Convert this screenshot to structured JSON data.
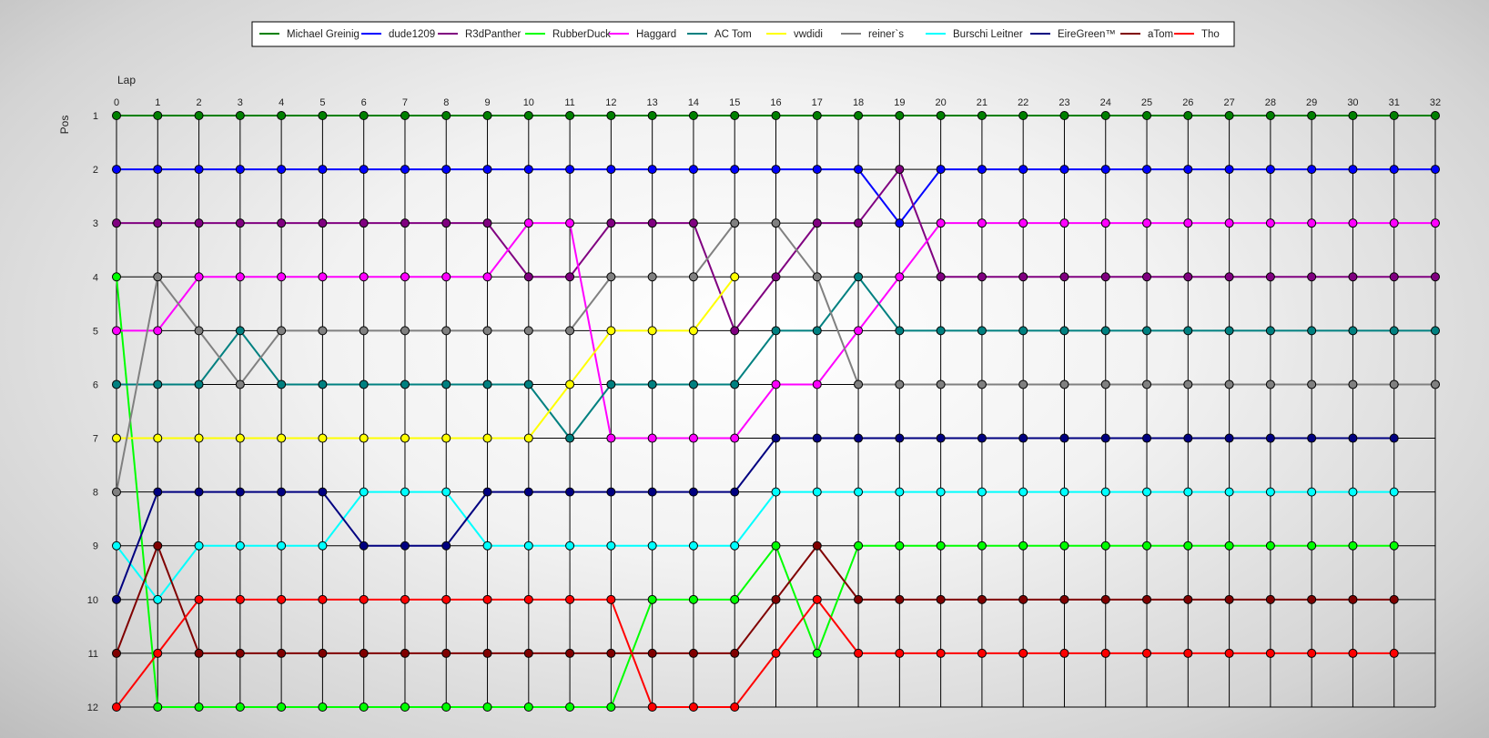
{
  "chart_data": {
    "type": "line",
    "xlabel": "Lap",
    "ylabel": "Pos",
    "x": [
      0,
      1,
      2,
      3,
      4,
      5,
      6,
      7,
      8,
      9,
      10,
      11,
      12,
      13,
      14,
      15,
      16,
      17,
      18,
      19,
      20,
      21,
      22,
      23,
      24,
      25,
      26,
      27,
      28,
      29,
      30,
      31,
      32
    ],
    "y_ticks": [
      1,
      2,
      3,
      4,
      5,
      6,
      7,
      8,
      9,
      10,
      11,
      12
    ],
    "ylim": [
      1,
      12
    ],
    "y_inverted": true,
    "xlim": [
      0,
      32
    ],
    "grid": true,
    "legend_position": "top-center",
    "series": [
      {
        "name": "Michael Greinig",
        "color": "#008000",
        "values": [
          1,
          1,
          1,
          1,
          1,
          1,
          1,
          1,
          1,
          1,
          1,
          1,
          1,
          1,
          1,
          1,
          1,
          1,
          1,
          1,
          1,
          1,
          1,
          1,
          1,
          1,
          1,
          1,
          1,
          1,
          1,
          1,
          1
        ]
      },
      {
        "name": "dude1209",
        "color": "#0000ff",
        "values": [
          2,
          2,
          2,
          2,
          2,
          2,
          2,
          2,
          2,
          2,
          2,
          2,
          2,
          2,
          2,
          2,
          2,
          2,
          2,
          3,
          2,
          2,
          2,
          2,
          2,
          2,
          2,
          2,
          2,
          2,
          2,
          2,
          2
        ]
      },
      {
        "name": "R3dPanther",
        "color": "#800080",
        "values": [
          3,
          3,
          3,
          3,
          3,
          3,
          3,
          3,
          3,
          3,
          4,
          4,
          3,
          3,
          3,
          5,
          4,
          3,
          3,
          2,
          4,
          4,
          4,
          4,
          4,
          4,
          4,
          4,
          4,
          4,
          4,
          4,
          4
        ]
      },
      {
        "name": "RubberDuck",
        "color": "#00ff00",
        "values": [
          4,
          12,
          12,
          12,
          12,
          12,
          12,
          12,
          12,
          12,
          12,
          12,
          12,
          10,
          10,
          10,
          9,
          11,
          9,
          9,
          9,
          9,
          9,
          9,
          9,
          9,
          9,
          9,
          9,
          9,
          9,
          9
        ]
      },
      {
        "name": "Haggard",
        "color": "#ff00ff",
        "values": [
          5,
          5,
          4,
          4,
          4,
          4,
          4,
          4,
          4,
          4,
          3,
          3,
          7,
          7,
          7,
          7,
          6,
          6,
          5,
          4,
          3,
          3,
          3,
          3,
          3,
          3,
          3,
          3,
          3,
          3,
          3,
          3,
          3
        ]
      },
      {
        "name": "AC Tom",
        "color": "#008080",
        "values": [
          6,
          6,
          6,
          5,
          6,
          6,
          6,
          6,
          6,
          6,
          6,
          7,
          6,
          6,
          6,
          6,
          5,
          5,
          4,
          5,
          5,
          5,
          5,
          5,
          5,
          5,
          5,
          5,
          5,
          5,
          5,
          5,
          5
        ]
      },
      {
        "name": "vwdidi",
        "color": "#ffff00",
        "values": [
          7,
          7,
          7,
          7,
          7,
          7,
          7,
          7,
          7,
          7,
          7,
          6,
          5,
          5,
          5,
          4
        ]
      },
      {
        "name": "reiner`s",
        "color": "#808080",
        "values": [
          8,
          4,
          5,
          6,
          5,
          5,
          5,
          5,
          5,
          5,
          5,
          5,
          4,
          4,
          4,
          3,
          3,
          4,
          6,
          6,
          6,
          6,
          6,
          6,
          6,
          6,
          6,
          6,
          6,
          6,
          6,
          6,
          6
        ]
      },
      {
        "name": "Burschi Leitner",
        "color": "#00ffff",
        "values": [
          9,
          10,
          9,
          9,
          9,
          9,
          8,
          8,
          8,
          9,
          9,
          9,
          9,
          9,
          9,
          9,
          8,
          8,
          8,
          8,
          8,
          8,
          8,
          8,
          8,
          8,
          8,
          8,
          8,
          8,
          8,
          8
        ]
      },
      {
        "name": "EireGreen™",
        "color": "#000080",
        "values": [
          10,
          8,
          8,
          8,
          8,
          8,
          9,
          9,
          9,
          8,
          8,
          8,
          8,
          8,
          8,
          8,
          7,
          7,
          7,
          7,
          7,
          7,
          7,
          7,
          7,
          7,
          7,
          7,
          7,
          7,
          7,
          7
        ]
      },
      {
        "name": "aTom",
        "color": "#800000",
        "values": [
          11,
          9,
          11,
          11,
          11,
          11,
          11,
          11,
          11,
          11,
          11,
          11,
          11,
          11,
          11,
          11,
          10,
          9,
          10,
          10,
          10,
          10,
          10,
          10,
          10,
          10,
          10,
          10,
          10,
          10,
          10,
          10
        ]
      },
      {
        "name": "Tho",
        "color": "#ff0000",
        "values": [
          12,
          11,
          10,
          10,
          10,
          10,
          10,
          10,
          10,
          10,
          10,
          10,
          10,
          12,
          12,
          12,
          11,
          10,
          11,
          11,
          11,
          11,
          11,
          11,
          11,
          11,
          11,
          11,
          11,
          11,
          11,
          11
        ]
      }
    ]
  }
}
